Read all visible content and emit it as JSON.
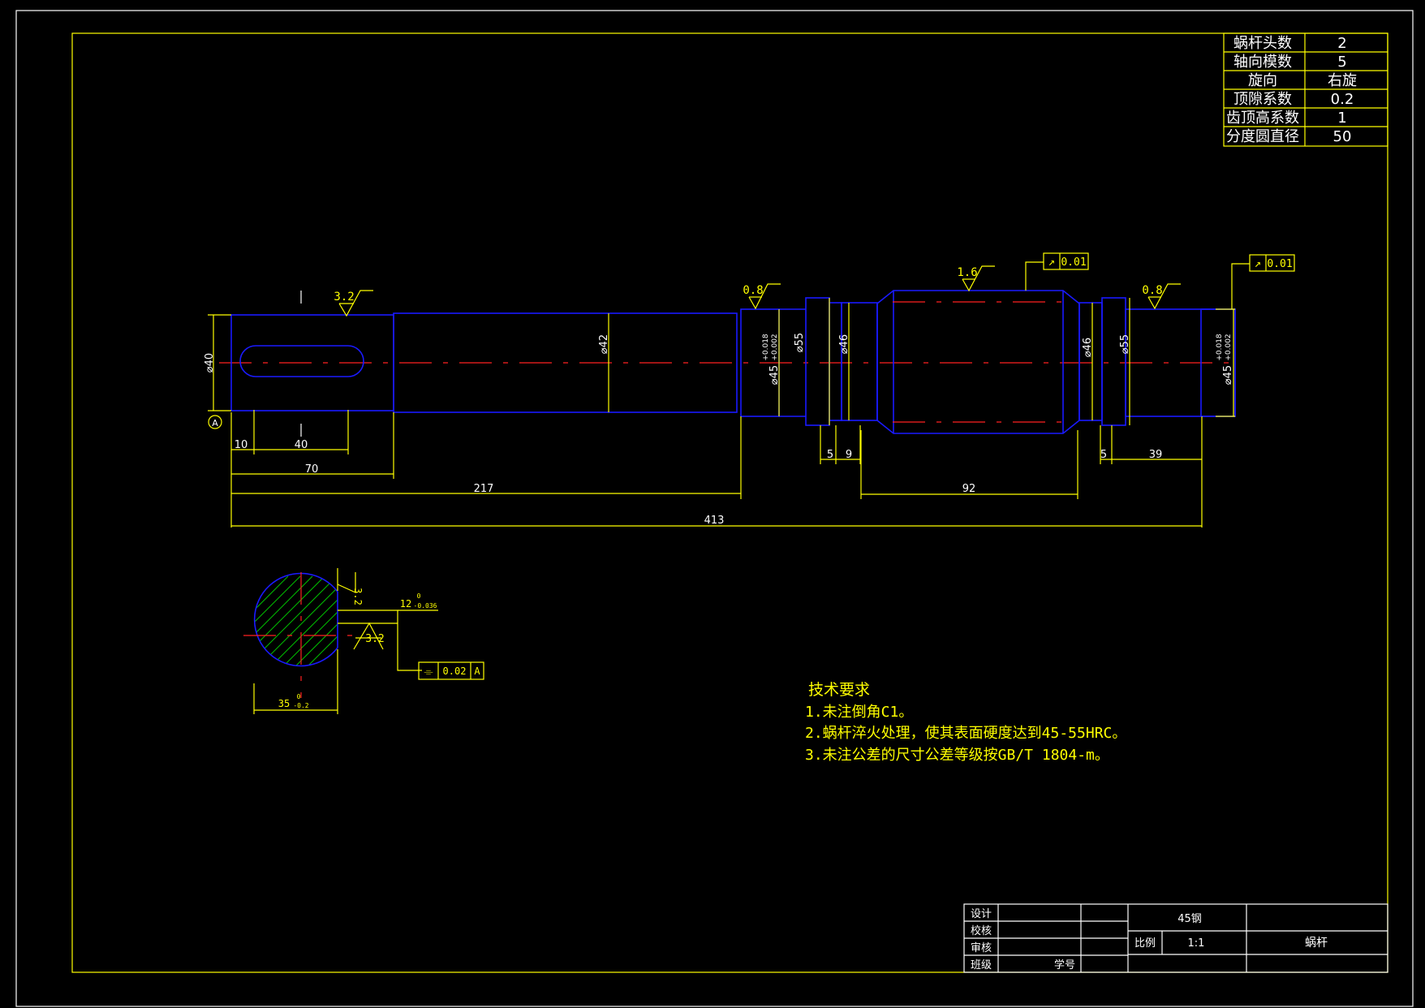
{
  "params": [
    {
      "name": "蜗杆头数",
      "value": "2"
    },
    {
      "name": "轴向模数",
      "value": "5"
    },
    {
      "name": "旋向",
      "value": "右旋"
    },
    {
      "name": "顶隙系数",
      "value": "0.2"
    },
    {
      "name": "齿顶高系数",
      "value": "1"
    },
    {
      "name": "分度圆直径",
      "value": "50"
    }
  ],
  "roughness": {
    "r1": "3.2",
    "r2": "0.8",
    "r3": "1.6",
    "r4": "0.8",
    "sec1": "3.2",
    "sec2": "3.2"
  },
  "runout": {
    "sym": "↗",
    "value": "0.01"
  },
  "diameters": {
    "d40": "⌀40",
    "d42": "⌀42",
    "d45a": "⌀45",
    "d45tol_hi": "+0.018",
    "d45tol_lo": "+0.002",
    "d55": "⌀55",
    "d46": "⌀46"
  },
  "datum": "A",
  "dims": {
    "d10": "10",
    "d40": "40",
    "d70": "70",
    "d217": "217",
    "d413": "413",
    "d5a": "5",
    "d9": "9",
    "d92": "92",
    "d5b": "5",
    "d39": "39"
  },
  "section": {
    "key_width": "12",
    "key_tol_top": "0",
    "key_tol_bot": "-0.036",
    "depth": "35",
    "depth_tol_top": "0",
    "depth_tol_bot": "-0.2",
    "sym_symbol": "⌯",
    "sym_value": "0.02",
    "sym_datum": "A"
  },
  "notes": {
    "title": "技术要求",
    "items": [
      "1.未注倒角C1。",
      "2.蜗杆淬火处理，使其表面硬度达到45-55HRC。",
      "3.未注公差的尺寸公差等级按GB/T 1804-m。"
    ]
  },
  "title_block": {
    "design": "设计",
    "check": "校核",
    "review": "审核",
    "class": "班级",
    "student_no": "学号",
    "material": "45钢",
    "scale_label": "比例",
    "scale": "1:1",
    "part_name": "蜗杆"
  },
  "colors": {
    "outline": "#ffff00",
    "part": "#1a1aff",
    "centerline": "#ff2020",
    "hatch": "#00c000"
  }
}
